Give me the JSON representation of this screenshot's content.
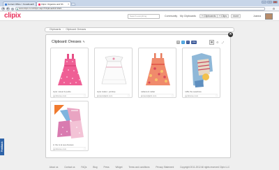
{
  "browser": {
    "tabs": [
      {
        "label": "Current Office > Snowboard"
      },
      {
        "label": "Clipix: Organize and Sh"
      }
    ],
    "url": "www.clipix.com/Clipix.aspx?ClipboardId=1622..."
  },
  "header": {
    "logo": "clipix",
    "search_placeholder": "Search everything",
    "nav": {
      "community": "Community",
      "my_clipboards": "My Clipboards",
      "clipboards": "+ Clipboards",
      "clips": "+ Clips",
      "more": "more"
    },
    "user_name": "Joanna"
  },
  "breadcrumb": {
    "root": "Clipboards",
    "current": "Clipboard: Dresses"
  },
  "panel": {
    "title": "Clipboard: Dresses",
    "cards": [
      {
        "caption": "style: sweet & petite",
        "source": "gymboree.com"
      },
      {
        "caption": "style maker...pointsp",
        "source": "janieandjack.com"
      },
      {
        "caption": "cabana & cabar",
        "source": "janieandjack.com"
      },
      {
        "caption": "ruffle the seashore",
        "source": "gymboree.com"
      },
      {
        "caption": "in the is at sea dresses",
        "source": "gymboree.com"
      }
    ]
  },
  "feedback": "Feedback",
  "footer": {
    "links": [
      "About us",
      "Contact us",
      "FAQs",
      "Blog",
      "Press",
      "Widget",
      "Terms and conditions",
      "Privacy Statement"
    ],
    "copyright": "Copyright 2011-2012 All rights reserved Clipix LLC"
  },
  "colors": {
    "brand": "#e8355f",
    "feedback_bg": "#2e63a8"
  }
}
